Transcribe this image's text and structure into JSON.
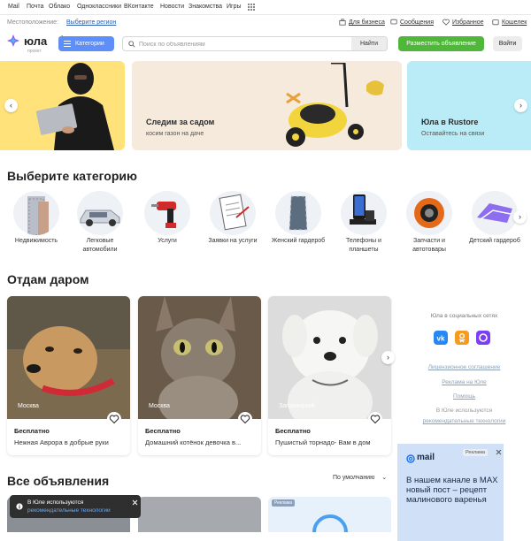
{
  "topnav": {
    "links": [
      "Mail",
      "Почта",
      "Облако",
      "Одноклассники",
      "ВКонтакте",
      "Новости",
      "Знакомства",
      "Игры"
    ]
  },
  "location": {
    "label": "Местоположение:",
    "select": "Выберите регион"
  },
  "user_links": {
    "business": "Для бизнеса",
    "messages": "Сообщения",
    "favorites": "Избранное",
    "wallet": "Кошелек"
  },
  "header": {
    "logo": "юла",
    "logo_sub": "проект",
    "categories_button": "Категории",
    "search_placeholder": "Поиск по объявлениям",
    "search_button": "Найти",
    "post_button": "Разместить объявление",
    "login_button": "Войти"
  },
  "banners": [
    {
      "title": "",
      "subtitle": ""
    },
    {
      "title": "Следим за садом",
      "subtitle": "косим газон на даче"
    },
    {
      "title": "Юла в Rustore",
      "subtitle": "Оставайтесь на связи"
    }
  ],
  "categories_section": {
    "title": "Выберите категорию",
    "items": [
      {
        "name": "Недвижимость",
        "icon": "building-icon"
      },
      {
        "name": "Легковые автомобили",
        "icon": "car-icon"
      },
      {
        "name": "Услуги",
        "icon": "drill-icon"
      },
      {
        "name": "Заявки на услуги",
        "icon": "clipboard-icon"
      },
      {
        "name": "Женский гардероб",
        "icon": "scarf-icon"
      },
      {
        "name": "Телефоны и планшеты",
        "icon": "phone-icon"
      },
      {
        "name": "Запчасти и автотовары",
        "icon": "tire-icon"
      },
      {
        "name": "Детский гардероб",
        "icon": "clothes-icon"
      }
    ]
  },
  "free_section": {
    "title": "Отдам даром",
    "items": [
      {
        "location": "Москва",
        "price": "Бесплатно",
        "title": "Нежная Аврора в добрые руки"
      },
      {
        "location": "Москва",
        "price": "Бесплатно",
        "title": "Домашний котёнок девочка в..."
      },
      {
        "location": "Загорянский",
        "price": "Бесплатно",
        "title": "Пушистый торнадо- Вам в дом"
      }
    ]
  },
  "side": {
    "social_caption": "Юла в социальных сетях",
    "links": [
      "Лицензионное соглашение",
      "Реклама на Юле",
      "Помощь"
    ],
    "tech_text": "В Юле используются",
    "tech_link": "рекомендательные технологии"
  },
  "all_section": {
    "title": "Все объявления",
    "sort": "По умолчанию",
    "ad_badge": "Реклама"
  },
  "ad": {
    "brand": "mail",
    "badge": "Реклама",
    "text": "В нашем канале в MAX новый пост – рецепт малинового варенья"
  },
  "toast": {
    "text": "В Юле используются",
    "link": "рекомендательные технологии"
  },
  "colors": {
    "accent": "#5e8ef7",
    "post": "#4fb83b"
  }
}
